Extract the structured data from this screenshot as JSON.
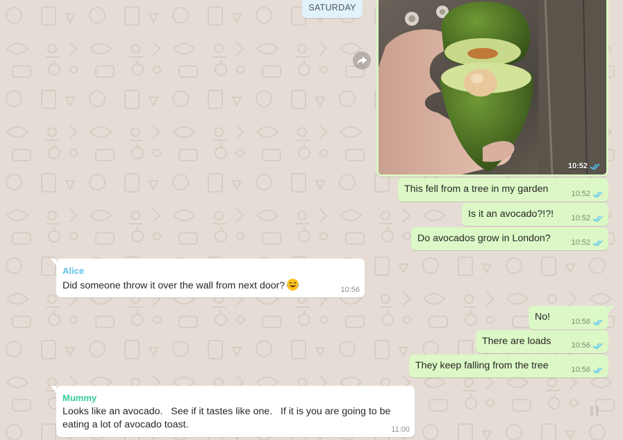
{
  "date_separator": "SATURDAY",
  "colors": {
    "background": "#e5ddd5",
    "outgoing": "#dcf8c6",
    "incoming": "#ffffff",
    "read_ticks": "#4fc3f7",
    "alice": "#5fc3e7",
    "mummy": "#35cd96"
  },
  "photo_message": {
    "time": "10:52",
    "status_icon": "double-check-read-icon"
  },
  "outgoing_group_1": [
    {
      "text": "This fell from a tree in my garden",
      "time": "10:52"
    },
    {
      "text": "Is it an avocado?!?!",
      "time": "10:52"
    },
    {
      "text": "Do avocados grow in London?",
      "time": "10:52"
    }
  ],
  "alice_message": {
    "sender": "Alice",
    "text": "Did someone throw it over the wall from next door?",
    "emoji": "laughing-tears-emoji",
    "time": "10:56"
  },
  "outgoing_group_2": [
    {
      "text": "No!",
      "time": "10:56"
    },
    {
      "text": "There are loads",
      "time": "10:56"
    },
    {
      "text": "They keep falling from the tree",
      "time": "10:56"
    }
  ],
  "mummy_message": {
    "sender": "Mummy",
    "line1": "Looks like an avocado.   See if it tastes like one.   If it is you are going to be",
    "line2": "eating a lot of avocado toast.",
    "time": "11:00"
  }
}
